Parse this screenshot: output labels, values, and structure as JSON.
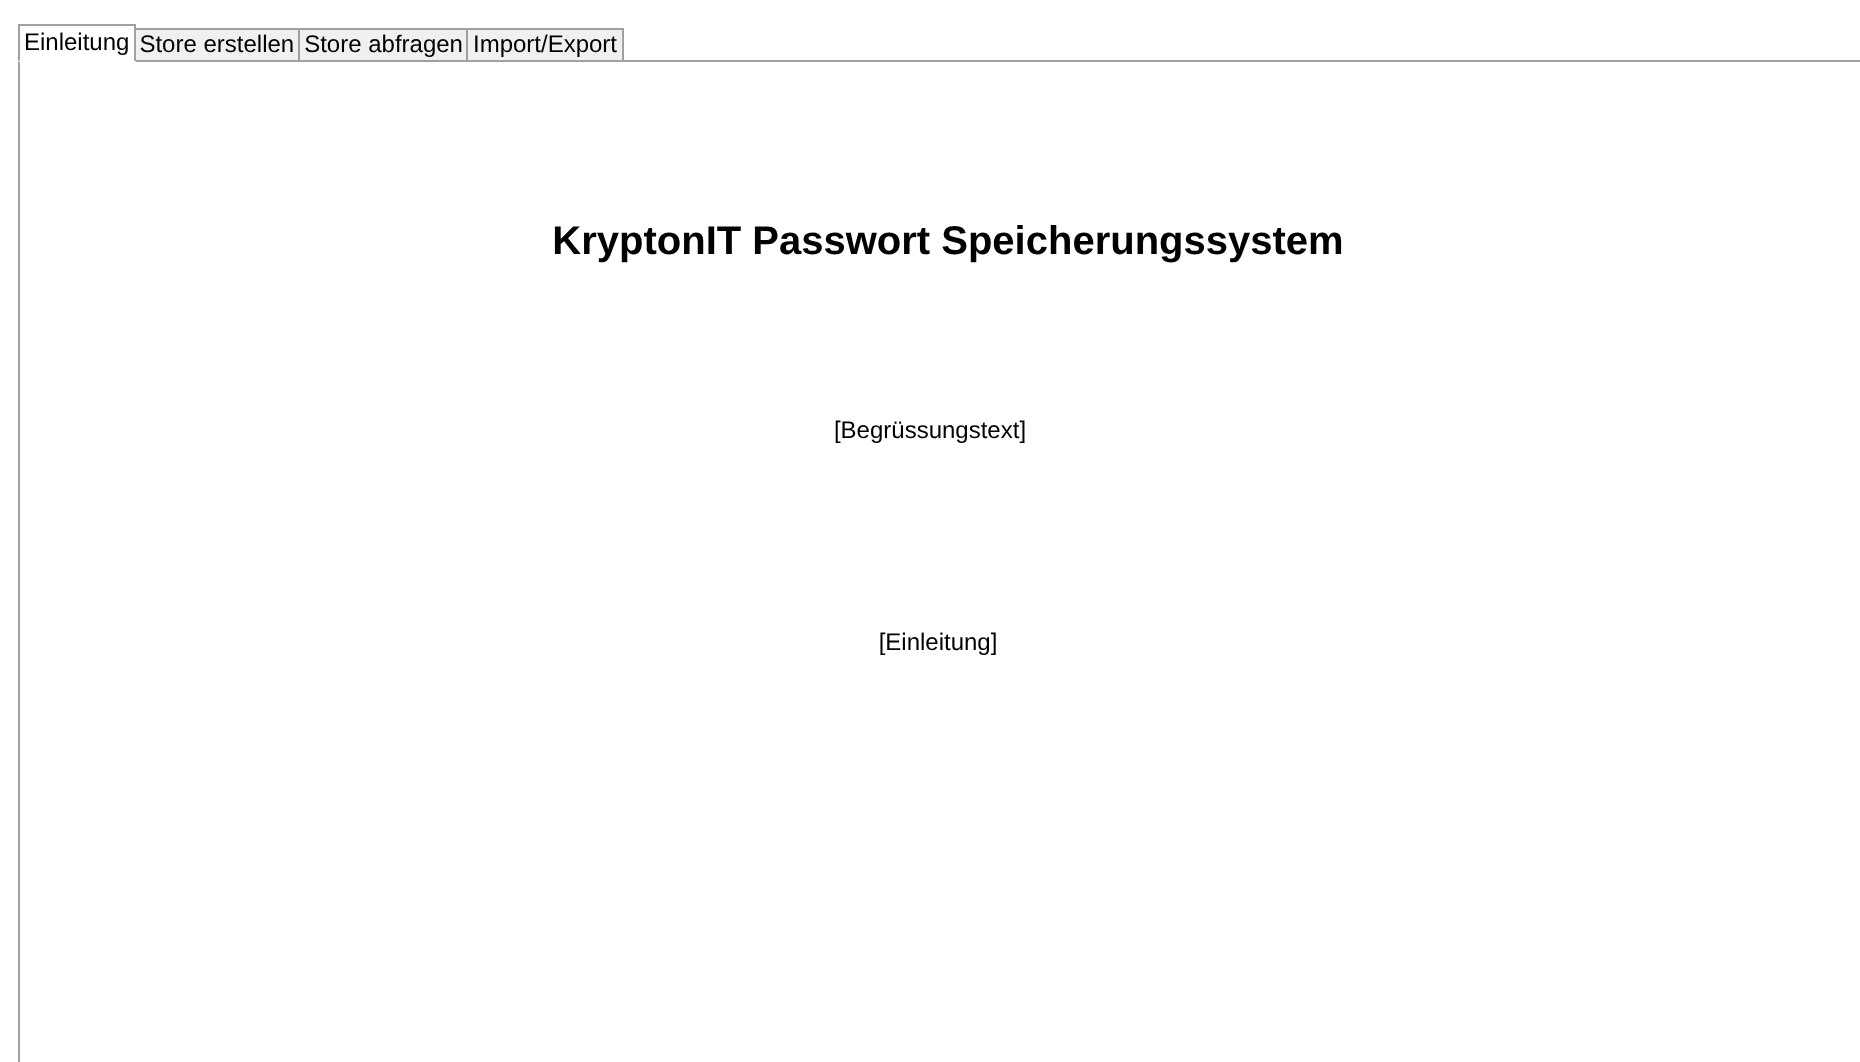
{
  "tabs": [
    {
      "label": "Einleitung",
      "selected": true
    },
    {
      "label": "Store erstellen",
      "selected": false
    },
    {
      "label": "Store abfragen",
      "selected": false
    },
    {
      "label": "Import/Export",
      "selected": false
    }
  ],
  "panel": {
    "title": "KryptonIT Passwort Speicherungssystem",
    "welcome": "[Begrüssungstext]",
    "intro": "[Einleitung]"
  }
}
